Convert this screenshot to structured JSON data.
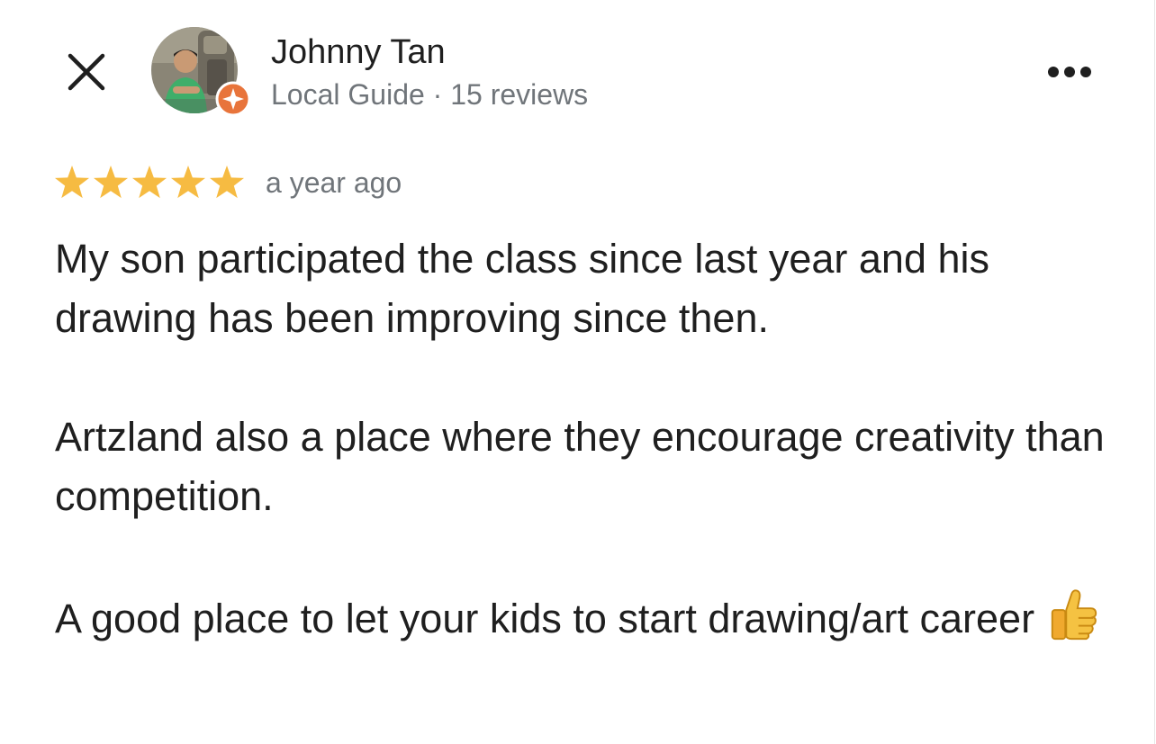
{
  "reviewer": {
    "name": "Johnny Tan",
    "badge": "Local Guide",
    "separator": "·",
    "review_count": "15 reviews"
  },
  "review": {
    "rating": 5,
    "max_rating": 5,
    "time": "a year ago",
    "paragraphs": [
      "My son participated the class since last year and his drawing has been improving since then.",
      "Artzland also a place where they encourage creativity than competition.",
      "A good place to let your kids to start drawing/art career"
    ],
    "emoji_icon": "thumbs-up-icon"
  },
  "icons": {
    "close": "close-icon",
    "more": "more-options-icon",
    "star": "star-icon",
    "guide_badge": "local-guide-badge-icon"
  },
  "colors": {
    "star": "#f6bb42",
    "badge": "#e8743b",
    "text": "#1f1f1f",
    "secondary_text": "#70757a"
  }
}
